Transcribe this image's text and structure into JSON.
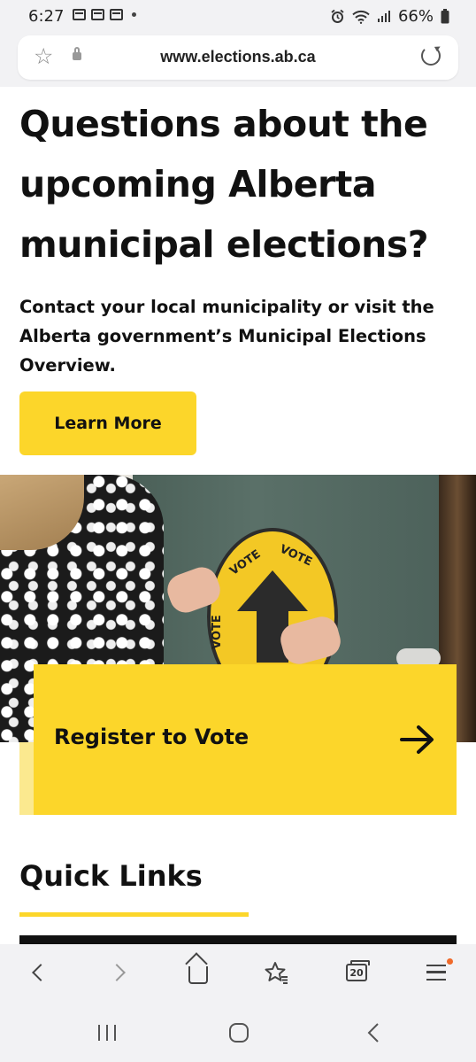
{
  "status_bar": {
    "time": "6:27",
    "battery": "66%",
    "left_icons": [
      "calendar-icon",
      "gallery-icon",
      "calendar-icon",
      "dot-icon"
    ],
    "right_icons": [
      "alarm-icon",
      "wifi-icon",
      "signal-icon",
      "battery-icon"
    ]
  },
  "browser": {
    "url": "www.elections.ab.ca"
  },
  "hero": {
    "title": "Questions about the upcoming Alberta municipal elections?",
    "text": "Contact your local municipality or visit the Alberta government’s Municipal Elections Overview.",
    "button_label": "Learn More"
  },
  "photo": {
    "sign_text_top": "VOTE",
    "sign_text_left": "VOTE",
    "sign_text_side": "VOTE"
  },
  "register": {
    "label": "Register to Vote"
  },
  "quick_links": {
    "title": "Quick Links"
  },
  "browser_nav": {
    "tab_count": "20"
  },
  "colors": {
    "accent_yellow": "#fcd62a",
    "text": "#111111",
    "chrome_bg": "#f2f2f4",
    "notification_dot": "#f06a2a"
  }
}
